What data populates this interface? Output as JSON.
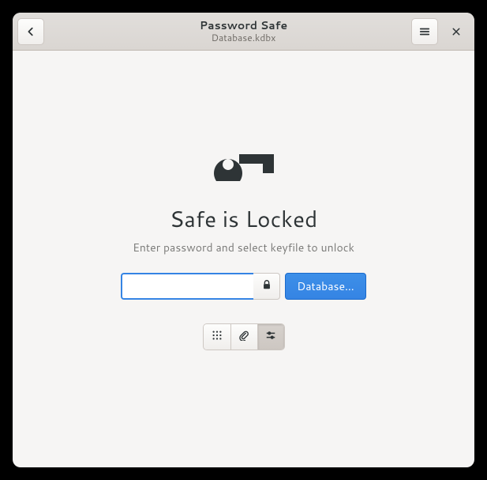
{
  "header": {
    "title": "Password Safe",
    "subtitle": "Database.kdbx"
  },
  "main": {
    "heading": "Safe is Locked",
    "subheading": "Enter password and select keyfile to unlock",
    "password_value": "",
    "password_placeholder": "",
    "keyfile_button": "Database…"
  },
  "icons": {
    "back": "back-icon",
    "menu": "hamburger-icon",
    "close": "close-icon",
    "key": "key-icon",
    "lock": "lock-icon",
    "keypad": "keypad-icon",
    "attachment": "attachment-icon",
    "settings": "sliders-icon"
  }
}
